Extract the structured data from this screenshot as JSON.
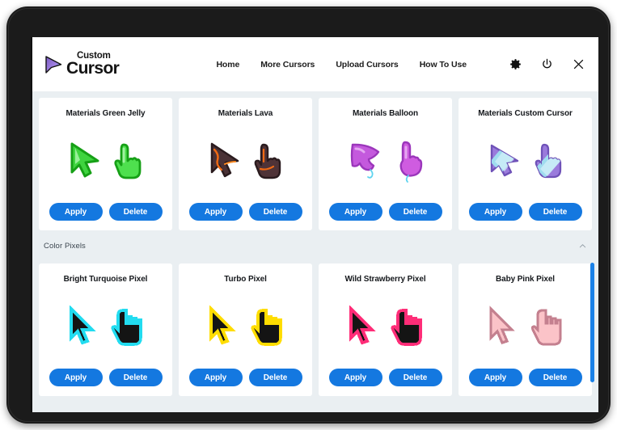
{
  "header": {
    "logo": {
      "icon": "cursor-arrow-logo",
      "line1": "Custom",
      "line2": "Cursor"
    },
    "nav": [
      {
        "label": "Home",
        "name": "nav-home"
      },
      {
        "label": "More Cursors",
        "name": "nav-more-cursors"
      },
      {
        "label": "Upload Cursors",
        "name": "nav-upload-cursors"
      },
      {
        "label": "How To Use",
        "name": "nav-how-to-use"
      }
    ],
    "icons": [
      {
        "name": "gear-icon"
      },
      {
        "name": "power-icon"
      },
      {
        "name": "close-icon"
      }
    ]
  },
  "buttons": {
    "apply": "Apply",
    "delete": "Delete"
  },
  "sections": [
    {
      "id": "materials",
      "header": null,
      "cards": [
        {
          "title": "Materials Green Jelly",
          "style": "jelly-green",
          "arrow": "#3fd43f",
          "arrow_dark": "#1fa61f",
          "hand": "#4ee04e"
        },
        {
          "title": "Materials Lava",
          "style": "lava",
          "arrow": "#4a3a3f",
          "arrow_dark": "#ef6a12",
          "hand": "#5a3a38"
        },
        {
          "title": "Materials Balloon",
          "style": "balloon",
          "arrow": "#c459dd",
          "arrow_dark": "#9b36bb",
          "hand": "#cf5ce0"
        },
        {
          "title": "Materials Custom Cursor",
          "style": "custom-stripe",
          "arrow": "#9a7bdc",
          "arrow_dark": "#7b5cc4",
          "hand": "#9a7bdc"
        }
      ]
    },
    {
      "id": "color-pixels",
      "header": {
        "title": "Color Pixels",
        "chevron": "chevron-up-icon"
      },
      "cards": [
        {
          "title": "Bright Turquoise Pixel",
          "style": "pixel",
          "outline": "#22dcf0",
          "fill": "#141414"
        },
        {
          "title": "Turbo Pixel",
          "style": "pixel",
          "outline": "#ffdd00",
          "fill": "#141414"
        },
        {
          "title": "Wild Strawberry Pixel",
          "style": "pixel",
          "outline": "#ff2d78",
          "fill": "#141414"
        },
        {
          "title": "Baby Pink Pixel",
          "style": "pixel",
          "outline": "#c4808f",
          "fill": "#fbc3c8"
        }
      ]
    }
  ],
  "scrollbar": {
    "color": "#1a81e8"
  }
}
